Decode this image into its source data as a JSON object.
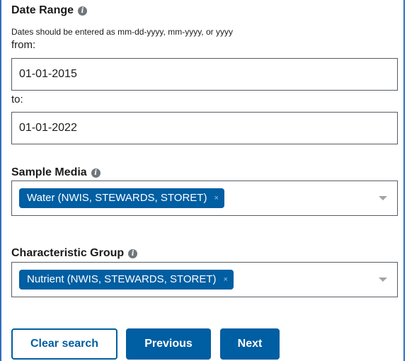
{
  "date_range": {
    "title": "Date Range",
    "hint": "Dates should be entered as mm-dd-yyyy, mm-yyyy, or yyyy",
    "from_label": "from:",
    "from_value": "01-01-2015",
    "to_label": "to:",
    "to_value": "01-01-2022"
  },
  "sample_media": {
    "title": "Sample Media",
    "selected": [
      "Water (NWIS, STEWARDS, STORET)"
    ]
  },
  "characteristic_group": {
    "title": "Characteristic Group",
    "selected": [
      "Nutrient (NWIS, STEWARDS, STORET)"
    ]
  },
  "chip_remove_glyph": "×",
  "buttons": {
    "clear": "Clear search",
    "previous": "Previous",
    "next": "Next"
  },
  "colors": {
    "primary": "#005ea2",
    "frame_border": "#2f6fbf",
    "input_border": "#565c65"
  },
  "icons": {
    "info": "info-icon",
    "remove": "close-icon",
    "dropdown": "chevron-down-icon"
  }
}
